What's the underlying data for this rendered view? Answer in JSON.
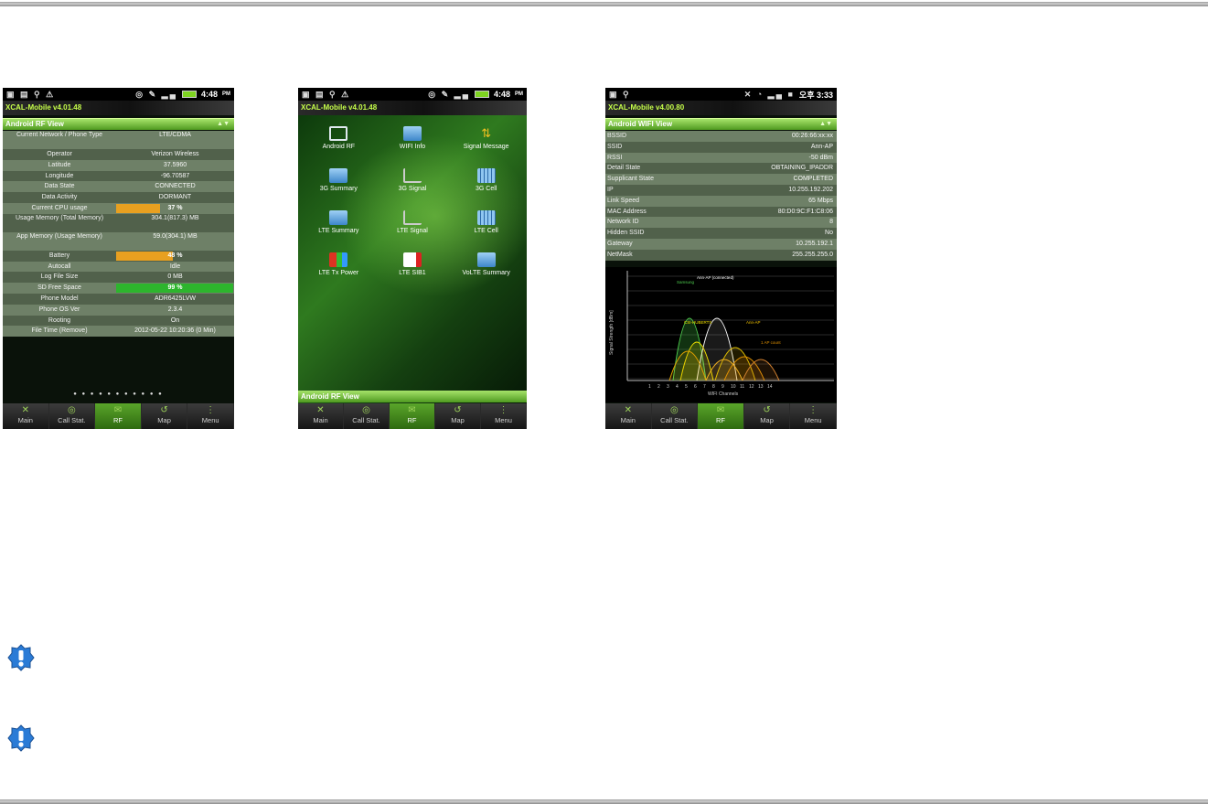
{
  "phones": [
    {
      "status": {
        "left_icons": "▣ ▤ ⚲ ⚠",
        "right_icons": "◎ ✎ ▂▄",
        "time": "4:48",
        "ampm": "PM"
      },
      "app_title": "XCAL-Mobile v4.01.48",
      "view_title": "Android RF View",
      "rows": [
        {
          "k": "Current Network / Phone Type",
          "v": "LTE/CDMA"
        },
        {
          "k": "Operator",
          "v": "Verizon Wireless"
        },
        {
          "k": "Latitude",
          "v": "37.5960"
        },
        {
          "k": "Longitude",
          "v": "-96.70587"
        },
        {
          "k": "Data State",
          "v": "CONNECTED"
        },
        {
          "k": "Data Activity",
          "v": "DORMANT"
        },
        {
          "k": "Current CPU usage",
          "v": "37 %",
          "bar": "orange",
          "pct": 37
        },
        {
          "k": "Usage Memory (Total Memory)",
          "v": "304.1(817.3) MB"
        },
        {
          "k": "App Memory (Usage Memory)",
          "v": "59.0(304.1) MB"
        },
        {
          "k": "Battery",
          "v": "48 %",
          "bar": "orange",
          "pct": 48
        },
        {
          "k": "Autocall",
          "v": "Idle"
        },
        {
          "k": "Log File Size",
          "v": "0 MB"
        },
        {
          "k": "SD Free Space",
          "v": "99 %",
          "bar": "green",
          "pct": 99
        },
        {
          "k": "Phone Model",
          "v": "ADR6425LVW"
        },
        {
          "k": "Phone OS Ver",
          "v": "2.3.4"
        },
        {
          "k": "Rooting",
          "v": "On"
        },
        {
          "k": "File Time (Remove)",
          "v": "2012-05-22 10:20:36 (0 Min)"
        }
      ],
      "page_dots": "● ● ● ● ● ● ● ● ● ● ●",
      "tabs": [
        "Main",
        "Call Stat.",
        "RF",
        "Map",
        "Menu"
      ],
      "active_tab": "RF"
    },
    {
      "status": {
        "left_icons": "▣ ▤ ⚲ ⚠",
        "right_icons": "◎ ✎ ▂▄",
        "time": "4:48",
        "ampm": "PM"
      },
      "app_title": "XCAL-Mobile v4.01.48",
      "apps": [
        {
          "label": "Android RF",
          "icon": "i-rf"
        },
        {
          "label": "WIFI Info",
          "icon": "i-wifi"
        },
        {
          "label": "Signal Message",
          "icon": "i-sig"
        },
        {
          "label": "3G Summary",
          "icon": "i-sum"
        },
        {
          "label": "3G Signal",
          "icon": "i-line"
        },
        {
          "label": "3G Cell",
          "icon": "i-cell"
        },
        {
          "label": "LTE Summary",
          "icon": "i-sum"
        },
        {
          "label": "LTE Signal",
          "icon": "i-line"
        },
        {
          "label": "LTE Cell",
          "icon": "i-cell"
        },
        {
          "label": "LTE Tx Power",
          "icon": "i-tx"
        },
        {
          "label": "LTE SIB1",
          "icon": "i-sib"
        },
        {
          "label": "VoLTE Summary",
          "icon": "i-sum"
        }
      ],
      "bottom_title": "Android RF View",
      "tabs": [
        "Main",
        "Call Stat.",
        "RF",
        "Map",
        "Menu"
      ],
      "active_tab": "RF"
    },
    {
      "status": {
        "left_icons": "▣ ⚲",
        "right_icons": "✕ ◔ ▂▄ ■",
        "time": "오후 3:33",
        "ampm": ""
      },
      "app_title": "XCAL-Mobile v4.00.80",
      "view_title": "Android WIFI View",
      "rows": [
        {
          "k": "BSSID",
          "v": "00:26:66:xx:xx"
        },
        {
          "k": "SSID",
          "v": "Ann-AP"
        },
        {
          "k": "RSSI",
          "v": "-50 dBm"
        },
        {
          "k": "Detail State",
          "v": "OBTAINING_IPADDR"
        },
        {
          "k": "Supplicant State",
          "v": "COMPLETED"
        },
        {
          "k": "IP",
          "v": "10.255.192.202"
        },
        {
          "k": "Link Speed",
          "v": "65 Mbps"
        },
        {
          "k": "MAC Address",
          "v": "80:D0:9C:F1:C8:06"
        },
        {
          "k": "Network ID",
          "v": "8"
        },
        {
          "k": "Hidden SSID",
          "v": "No"
        },
        {
          "k": "Gateway",
          "v": "10.255.192.1"
        },
        {
          "k": "NetMask",
          "v": "255.255.255.0"
        }
      ],
      "chart": {
        "ylabel": "Signal Strength [dBm]",
        "xlabel": "WIFI Channels",
        "channels": [
          "1",
          "2",
          "3",
          "4",
          "5",
          "6",
          "7",
          "8",
          "9",
          "10",
          "11",
          "12",
          "13",
          "14"
        ],
        "labels": {
          "a": "Samsung",
          "b": "Ann-AP (connected)",
          "c": "CSI-HUBERTS",
          "d": "Ann-AP",
          "e": "1 AP count"
        }
      },
      "tabs": [
        "Main",
        "Call Stat.",
        "RF",
        "Map",
        "Menu"
      ],
      "active_tab": "RF"
    }
  ]
}
